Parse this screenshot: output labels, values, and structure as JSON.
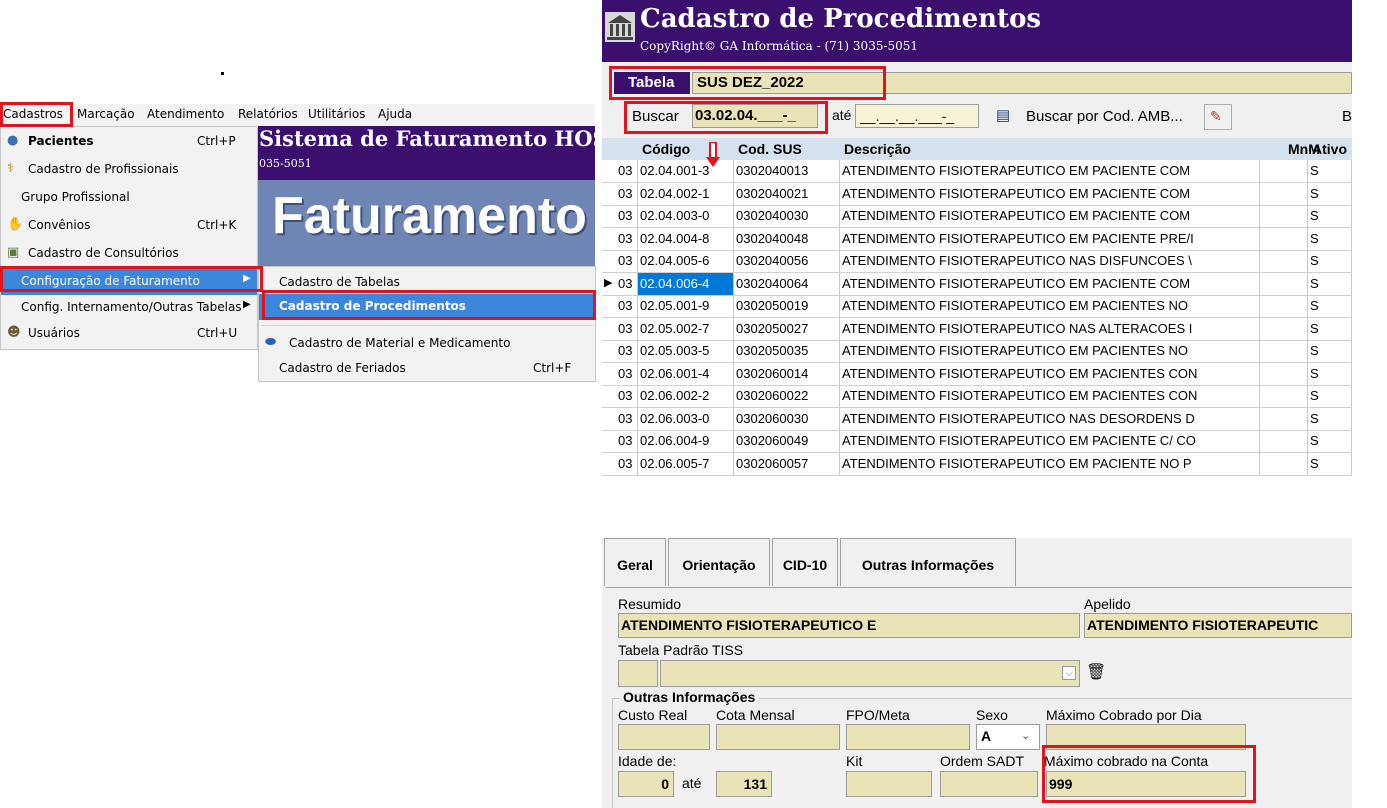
{
  "menubar": {
    "items": [
      "Cadastros",
      "Marcação",
      "Atendimento",
      "Relatórios",
      "Utilitários",
      "Ajuda"
    ]
  },
  "cadastros_menu": {
    "items": [
      {
        "label": "Pacientes",
        "shortcut": "Ctrl+P",
        "icon": "person-icon",
        "bold": true
      },
      {
        "label": "Cadastro de Profissionais",
        "shortcut": "",
        "icon": "caduceus-icon"
      },
      {
        "label": "Grupo Profissional",
        "shortcut": "",
        "icon": ""
      },
      {
        "label": "Convênios",
        "shortcut": "Ctrl+K",
        "icon": "handshake-icon"
      },
      {
        "label": "Cadastro de Consultórios",
        "shortcut": "",
        "icon": "building-icon"
      },
      {
        "label": "Configuração de Faturamento",
        "shortcut": "",
        "icon": "",
        "submenu": true,
        "highlighted": true
      },
      {
        "label": "Config. Internamento/Outras Tabelas",
        "shortcut": "",
        "icon": "",
        "submenu": true
      },
      {
        "label": "Usuários",
        "shortcut": "Ctrl+U",
        "icon": "users-icon"
      }
    ]
  },
  "faturamento_submenu": {
    "items": [
      {
        "label": "Cadastro de Tabelas",
        "shortcut": ""
      },
      {
        "label": "Cadastro de Procedimentos",
        "shortcut": "",
        "highlighted": true
      },
      {
        "label": "Cadastro de Material e Medicamento",
        "shortcut": "",
        "icon": "pill-icon"
      },
      {
        "label": "Cadastro de Feriados",
        "shortcut": "Ctrl+F"
      }
    ]
  },
  "background_app": {
    "title": "Sistema de Faturamento HOSP",
    "phone_fragment": "035-5051",
    "banner": "Faturamento"
  },
  "procedimentos": {
    "title": "Cadastro de Procedimentos",
    "copyright": "CopyRight© GA Informática - (71) 3035-5051",
    "tabela_label": "Tabela",
    "tabela_value": "SUS DEZ_2022",
    "buscar_label": "Buscar",
    "buscar_value": "03.02.04.___-_",
    "ate_label": "até",
    "ate_value": "__.__.__.___-_",
    "buscar_amb_label": "Buscar por Cod. AMB...",
    "trailing_b": "B",
    "grid": {
      "columns": [
        "Código",
        "Cod. SUS",
        "Descrição",
        "MnM",
        "Ativo"
      ],
      "rows": [
        {
          "grp": "03",
          "codigo": "02.04.001-3",
          "sus": "0302040013",
          "desc": "ATENDIMENTO FISIOTERAPEUTICO EM PACIENTE COM",
          "ativo": "S"
        },
        {
          "grp": "03",
          "codigo": "02.04.002-1",
          "sus": "0302040021",
          "desc": "ATENDIMENTO FISIOTERAPEUTICO EM PACIENTE COM",
          "ativo": "S"
        },
        {
          "grp": "03",
          "codigo": "02.04.003-0",
          "sus": "0302040030",
          "desc": "ATENDIMENTO FISIOTERAPEUTICO EM PACIENTE COM",
          "ativo": "S"
        },
        {
          "grp": "03",
          "codigo": "02.04.004-8",
          "sus": "0302040048",
          "desc": "ATENDIMENTO FISIOTERAPEUTICO EM PACIENTE PRE/I",
          "ativo": "S"
        },
        {
          "grp": "03",
          "codigo": "02.04.005-6",
          "sus": "0302040056",
          "desc": "ATENDIMENTO FISIOTERAPEUTICO NAS DISFUNCOES \\",
          "ativo": "S"
        },
        {
          "grp": "03",
          "codigo": "02.04.006-4",
          "sus": "0302040064",
          "desc": "ATENDIMENTO FISIOTERAPEUTICO EM PACIENTE COM",
          "ativo": "S",
          "current": true
        },
        {
          "grp": "03",
          "codigo": "02.05.001-9",
          "sus": "0302050019",
          "desc": "ATENDIMENTO FISIOTERAPEUTICO EM PACIENTES NO",
          "ativo": "S"
        },
        {
          "grp": "03",
          "codigo": "02.05.002-7",
          "sus": "0302050027",
          "desc": "ATENDIMENTO FISIOTERAPEUTICO NAS ALTERACOES I",
          "ativo": "S"
        },
        {
          "grp": "03",
          "codigo": "02.05.003-5",
          "sus": "0302050035",
          "desc": "ATENDIMENTO FISIOTERAPEUTICO EM PACIENTES NO",
          "ativo": "S"
        },
        {
          "grp": "03",
          "codigo": "02.06.001-4",
          "sus": "0302060014",
          "desc": "ATENDIMENTO FISIOTERAPEUTICO EM PACIENTES CON",
          "ativo": "S"
        },
        {
          "grp": "03",
          "codigo": "02.06.002-2",
          "sus": "0302060022",
          "desc": "ATENDIMENTO FISIOTERAPEUTICO EM PACIENTES CON",
          "ativo": "S"
        },
        {
          "grp": "03",
          "codigo": "02.06.003-0",
          "sus": "0302060030",
          "desc": "ATENDIMENTO FISIOTERAPEUTICO NAS DESORDENS D",
          "ativo": "S"
        },
        {
          "grp": "03",
          "codigo": "02.06.004-9",
          "sus": "0302060049",
          "desc": "ATENDIMENTO FISIOTERAPEUTICO EM PACIENTE C/ CO",
          "ativo": "S"
        },
        {
          "grp": "03",
          "codigo": "02.06.005-7",
          "sus": "0302060057",
          "desc": "ATENDIMENTO FISIOTERAPEUTICO EM PACIENTE NO P",
          "ativo": "S"
        }
      ]
    },
    "tabs": [
      "Geral",
      "Orientação",
      "CID-10",
      "Outras Informações"
    ],
    "geral": {
      "resumido_label": "Resumido",
      "resumido_value": "ATENDIMENTO FISIOTERAPEUTICO E",
      "apelido_label": "Apelido",
      "apelido_value": "ATENDIMENTO FISIOTERAPEUTIC",
      "tiss_label": "Tabela Padrão TISS",
      "outras_label": "Outras Informações",
      "custo_label": "Custo Real",
      "cota_label": "Cota Mensal",
      "fpo_label": "FPO/Meta",
      "sexo_label": "Sexo",
      "sexo_value": "A",
      "max_dia_label": "Máximo Cobrado por Dia",
      "idade_label": "Idade de:",
      "idade_de": "0",
      "idade_ate_label": "até",
      "idade_ate": "131",
      "kit_label": "Kit",
      "ordem_label": "Ordem SADT",
      "max_conta_label": "Máximo cobrado na Conta",
      "max_conta_value": "999"
    }
  },
  "colors": {
    "header_purple": "#3a0f6e",
    "highlight_blue": "#0078d7",
    "annotation_red": "#e0141e",
    "field_bg": "#e8e4b8"
  }
}
